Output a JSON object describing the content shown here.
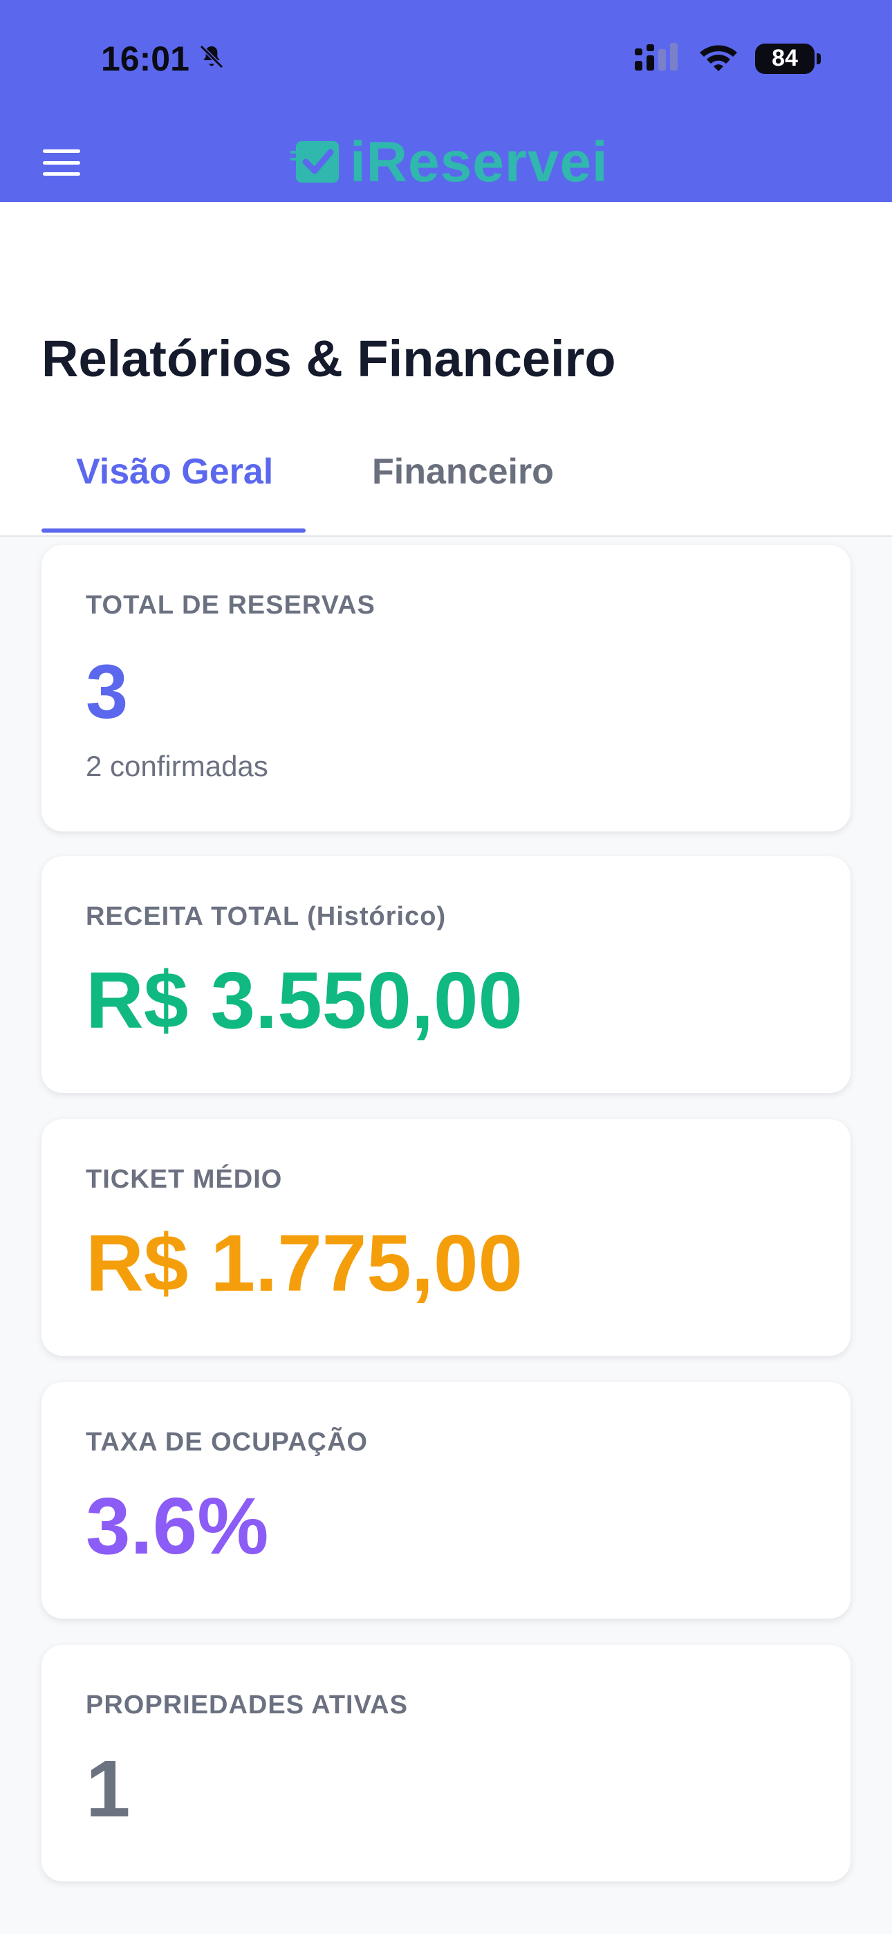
{
  "status_bar": {
    "time": "16:01",
    "battery": "84",
    "icons": [
      "bell-slash-icon",
      "cellular-signal-icon",
      "wifi-icon",
      "battery-icon"
    ]
  },
  "header": {
    "menu_icon": "hamburger-menu-icon",
    "logo_text": "iReservei",
    "logo_icon": "checkbox-icon",
    "brand_color": "#5b68ee",
    "logo_color": "#30b7ae"
  },
  "page": {
    "title": "Relatórios & Financeiro"
  },
  "tabs": [
    {
      "label": "Visão Geral",
      "active": true
    },
    {
      "label": "Financeiro",
      "active": false
    }
  ],
  "cards": {
    "total_reservas": {
      "label": "TOTAL DE RESERVAS",
      "value": "3",
      "sub": "2 confirmadas",
      "color": "#5b68ee"
    },
    "receita_total": {
      "label": "RECEITA TOTAL (Histórico)",
      "value": "R$ 3.550,00",
      "color": "#10b981"
    },
    "ticket_medio": {
      "label": "TICKET MÉDIO",
      "value": "R$ 1.775,00",
      "color": "#f59e0b"
    },
    "taxa_ocupacao": {
      "label": "TAXA DE OCUPAÇÃO",
      "value": "3.6%",
      "color": "#8b5cf6"
    },
    "propriedades_ativas": {
      "label": "PROPRIEDADES ATIVAS",
      "value": "1",
      "color": "#6b7280"
    }
  }
}
